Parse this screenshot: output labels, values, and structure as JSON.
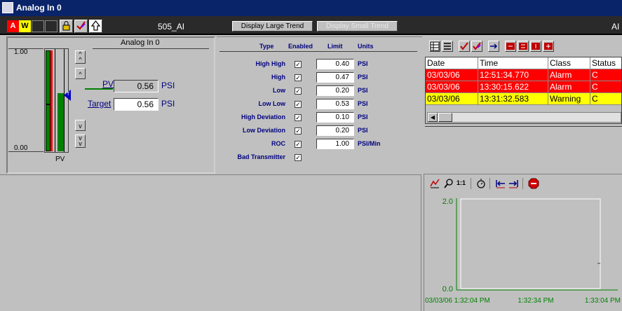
{
  "window": {
    "title": "Analog In 0"
  },
  "toolbar": {
    "alarm_letter": "A",
    "warning_letter": "W",
    "tag_name": "505_AI",
    "display_large_trend": "Display Large Trend",
    "display_small_trend": "Display Small Trend",
    "right_label": "AI"
  },
  "faceplate": {
    "title": "Analog In 0",
    "scale_max": "1.00",
    "scale_min": "0.00",
    "bar_label": "PV",
    "pv_label": "PV",
    "pv_value": "0.56",
    "pv_unit": "PSI",
    "target_label": "Target",
    "target_value": "0.56",
    "target_unit": "PSI",
    "target_marker": "T"
  },
  "limits": {
    "headers": {
      "type": "Type",
      "enabled": "Enabled",
      "limit": "Limit",
      "units": "Units"
    },
    "rows": [
      {
        "type": "High High",
        "limit": "0.40",
        "units": "PSI",
        "enabled": "✓"
      },
      {
        "type": "High",
        "limit": "0.47",
        "units": "PSI",
        "enabled": "✓"
      },
      {
        "type": "Low",
        "limit": "0.20",
        "units": "PSI",
        "enabled": "✓"
      },
      {
        "type": "Low Low",
        "limit": "0.53",
        "units": "PSI",
        "enabled": "✓"
      },
      {
        "type": "High Deviation",
        "limit": "0.10",
        "units": "PSI",
        "enabled": "✓"
      },
      {
        "type": "Low Deviation",
        "limit": "0.20",
        "units": "PSI",
        "enabled": "✓"
      },
      {
        "type": "ROC",
        "limit": "1.00",
        "units": "PSI/Min",
        "enabled": "✓"
      },
      {
        "type": "Bad Transmitter",
        "limit": "",
        "units": "",
        "enabled": "✓"
      }
    ]
  },
  "alarms": {
    "headers": {
      "date": "Date",
      "time": "Time",
      "class": "Class",
      "status": "Status"
    },
    "rows": [
      {
        "date": "03/03/06",
        "time": "12:51:34.770",
        "class": "Alarm",
        "status": "C",
        "color": "#ff0000"
      },
      {
        "date": "03/03/06",
        "time": "13:30:15.622",
        "class": "Alarm",
        "status": "C",
        "color": "#ff0000"
      },
      {
        "date": "03/03/06",
        "time": "13:31:32.583",
        "class": "Warning",
        "status": "C",
        "color": "#ffff00"
      }
    ]
  },
  "trend": {
    "zoom_label": "1:1",
    "y_max": "2.0",
    "y_min": "0.0",
    "x_labels": [
      "03/03/06 1:32:04 PM",
      "1:32:34 PM",
      "1:33:04 PM"
    ],
    "color": "#008000"
  }
}
